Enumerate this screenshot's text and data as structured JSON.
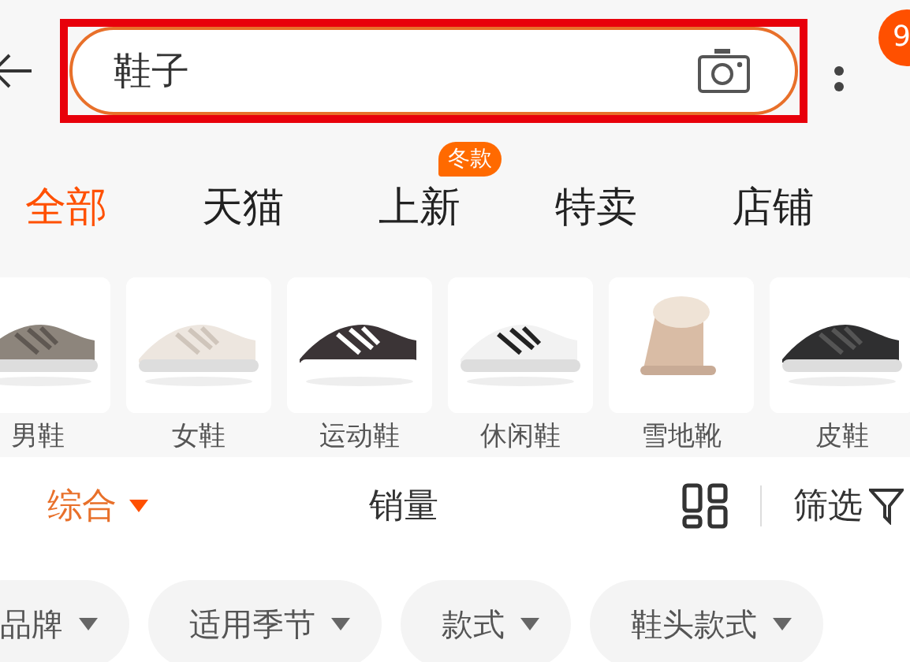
{
  "search": {
    "value": "鞋子",
    "highlighted": true
  },
  "notification_badge": "9",
  "tabs": [
    {
      "label": "全部",
      "selected": true
    },
    {
      "label": "天猫",
      "selected": false
    },
    {
      "label": "上新",
      "selected": false,
      "badge": "冬款"
    },
    {
      "label": "特卖",
      "selected": false
    },
    {
      "label": "店铺",
      "selected": false
    }
  ],
  "categories": [
    {
      "label": "男鞋",
      "kind": "picture"
    },
    {
      "label": "女鞋",
      "kind": "picture"
    },
    {
      "label": "运动鞋",
      "kind": "picture"
    },
    {
      "label": "休闲鞋",
      "kind": "picture"
    },
    {
      "label": "雪地靴",
      "kind": "picture"
    },
    {
      "label": "皮鞋",
      "kind": "picture"
    }
  ],
  "sort": [
    {
      "label": "综合",
      "selected": true,
      "kind": "dropdown"
    },
    {
      "label": "销量",
      "selected": false,
      "kind": "plain"
    }
  ],
  "filter": {
    "label": "筛选"
  },
  "chips": [
    {
      "label": "品牌"
    },
    {
      "label": "适用季节"
    },
    {
      "label": "款式"
    },
    {
      "label": "鞋头款式"
    }
  ]
}
